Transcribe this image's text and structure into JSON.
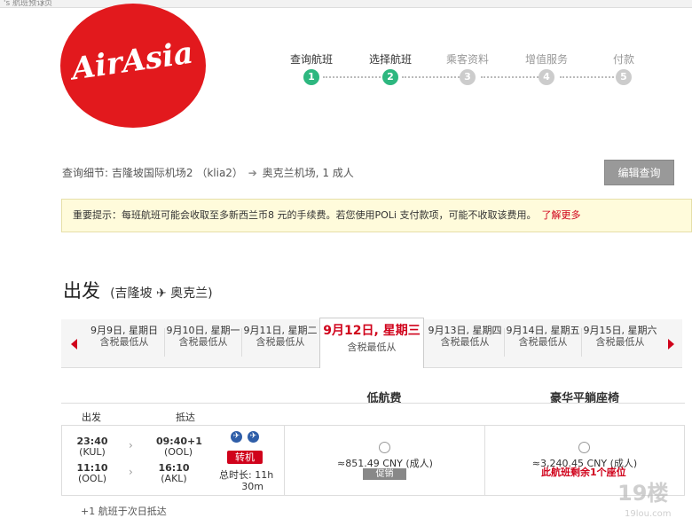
{
  "browser": {
    "tab_title": "'s 航班预订页",
    "tab_close": "×"
  },
  "brand": {
    "logo_text": "AirAsia",
    "color": "#e2191d"
  },
  "steps": [
    {
      "label": "查询航班",
      "number": "1",
      "state": "active"
    },
    {
      "label": "选择航班",
      "number": "2",
      "state": "active"
    },
    {
      "label": "乘客资料",
      "number": "3",
      "state": "inactive"
    },
    {
      "label": "增值服务",
      "number": "4",
      "state": "inactive"
    },
    {
      "label": "付款",
      "number": "5",
      "state": "inactive"
    }
  ],
  "search_summary": {
    "prefix": "查询细节:",
    "origin": "吉隆坡国际机场2 （klia2）",
    "arrow": "➔",
    "destination": "奥克兰机场,",
    "passengers": "1 成人"
  },
  "edit_button": "编辑查询",
  "notice": {
    "text": "重要提示：每班航班可能会收取至多新西兰币8 元的手续费。若您使用POLi 支付款项，可能不收取该费用。",
    "link": "了解更多"
  },
  "departure": {
    "title": "出发",
    "route": "(吉隆坡 ✈ 奥克兰)"
  },
  "date_tabs": [
    {
      "date": "9月9日, 星期日",
      "sub": "含税最低从"
    },
    {
      "date": "9月10日, 星期一",
      "sub": "含税最低从"
    },
    {
      "date": "9月11日, 星期二",
      "sub": "含税最低从"
    },
    {
      "date": "9月12日, 星期三",
      "sub": "含税最低从",
      "selected": true
    },
    {
      "date": "9月13日, 星期四",
      "sub": "含税最低从"
    },
    {
      "date": "9月14日, 星期五",
      "sub": "含税最低从"
    },
    {
      "date": "9月15日, 星期六",
      "sub": "含税最低从"
    }
  ],
  "fare_columns": {
    "economy": "低航费",
    "premium": "豪华平躺座椅"
  },
  "table_headers": {
    "depart": "出发",
    "arrive": "抵达"
  },
  "flight": {
    "leg1": {
      "dep_time": "23:40",
      "dep_code": "(KUL)",
      "arr_time": "09:40+1",
      "arr_code": "(OOL)"
    },
    "leg2": {
      "dep_time": "11:10",
      "dep_code": "(OOL)",
      "arr_time": "16:10",
      "arr_code": "(AKL)"
    },
    "transfer_label": "转机",
    "duration_line1": "总时长: 11h",
    "duration_line2": "30m",
    "economy_price": "≈851.49 CNY (成人)",
    "economy_badge": "促销",
    "premium_price": "≈3,240.45 CNY (成人)",
    "premium_note": "此航班剩余1个座位"
  },
  "footnote": "+1 航班于次日抵达",
  "watermark": {
    "text": "19楼",
    "sub": "19lou.com"
  }
}
